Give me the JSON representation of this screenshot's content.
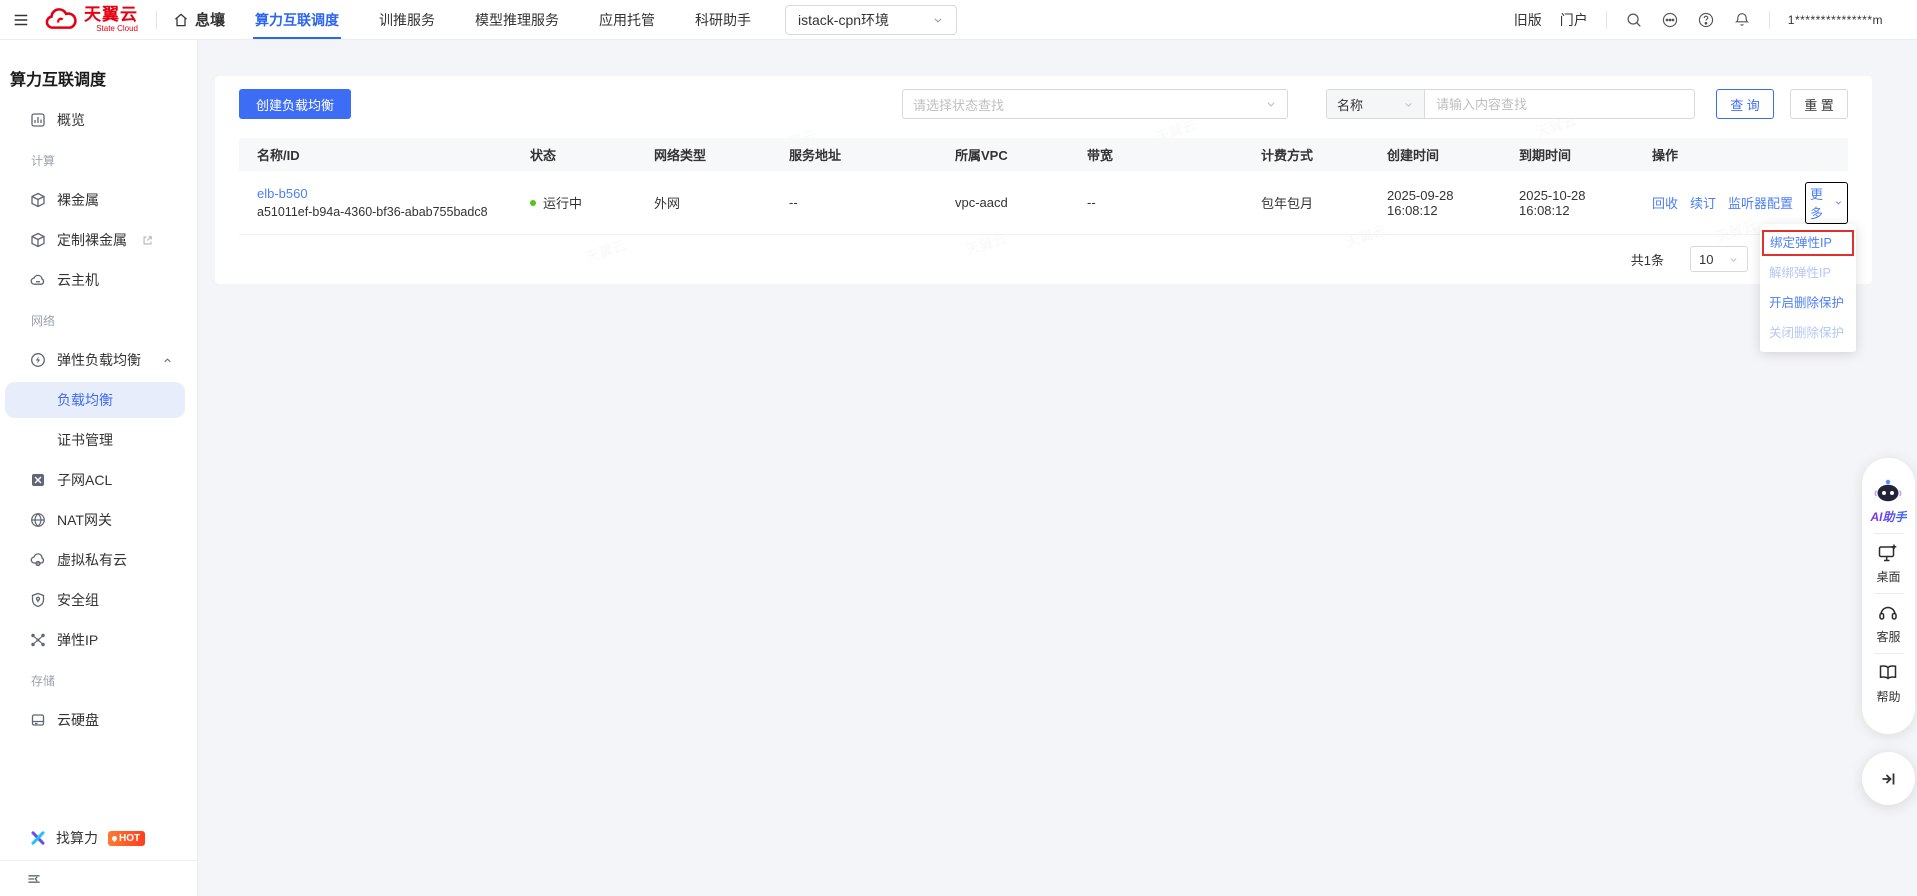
{
  "colors": {
    "accent": "#3d6df5",
    "link": "#4d7ef7",
    "logo_red": "#e60012",
    "status_green": "#52c41a",
    "annotation_red": "#e0312f",
    "hot_badge": "#ff4d20"
  },
  "topbar": {
    "logo_title": "天翼云",
    "logo_subtitle": "State Cloud",
    "home_label": "息壤",
    "tabs": [
      {
        "label": "算力互联调度",
        "active": true
      },
      {
        "label": "训推服务",
        "active": false
      },
      {
        "label": "模型推理服务",
        "active": false
      },
      {
        "label": "应用托管",
        "active": false
      },
      {
        "label": "科研助手",
        "active": false
      }
    ],
    "env_select_value": "istack-cpn环境",
    "link_old_version": "旧版",
    "link_portal": "门户",
    "username": "1***************m"
  },
  "sidebar": {
    "title": "算力互联调度",
    "items": [
      {
        "label": "概览"
      },
      {
        "section": "计算"
      },
      {
        "label": "裸金属"
      },
      {
        "label": "定制裸金属"
      },
      {
        "label": "云主机"
      },
      {
        "section": "网络"
      },
      {
        "label": "弹性负载均衡"
      },
      {
        "label": "负载均衡",
        "active": true
      },
      {
        "label": "证书管理"
      },
      {
        "label": "子网ACL"
      },
      {
        "label": "NAT网关"
      },
      {
        "label": "虚拟私有云"
      },
      {
        "label": "安全组"
      },
      {
        "label": "弹性IP"
      },
      {
        "section": "存储"
      },
      {
        "label": "云硬盘"
      }
    ],
    "find_compute": {
      "label": "找算力",
      "badge": "HOT"
    }
  },
  "main": {
    "watermark": "天翼云",
    "create_button": "创建负载均衡",
    "status_filter_placeholder": "请选择状态查找",
    "field_select_value": "名称",
    "search_placeholder": "请输入内容查找",
    "query_button": "查 询",
    "reset_button": "重 置",
    "table": {
      "columns": [
        "名称/ID",
        "状态",
        "网络类型",
        "服务地址",
        "所属VPC",
        "带宽",
        "计费方式",
        "创建时间",
        "到期时间",
        "操作"
      ],
      "row": {
        "name": "elb-b560",
        "id": "a51011ef-b94a-4360-bf36-abab755badc8",
        "status": "运行中",
        "network_type": "外网",
        "service_address": "--",
        "vpc": "vpc-aacd",
        "bandwidth": "--",
        "billing": "包年包月",
        "created": "2025-09-28 16:08:12",
        "expires": "2025-10-28 16:08:12",
        "actions": [
          "回收",
          "续订",
          "监听器配置"
        ],
        "more_label": "更多"
      }
    },
    "pagination": {
      "total": "共1条",
      "page_size": "10"
    },
    "more_menu": {
      "items": [
        {
          "label": "绑定弹性IP",
          "state": "highlighted"
        },
        {
          "label": "解绑弹性IP",
          "state": "disabled"
        },
        {
          "label": "开启删除保护",
          "state": "enabled"
        },
        {
          "label": "关闭删除保护",
          "state": "disabled"
        }
      ]
    }
  },
  "float_toolbar": {
    "ai_label": "AI助手",
    "desktop_label": "桌面",
    "support_label": "客服",
    "help_label": "帮助"
  }
}
